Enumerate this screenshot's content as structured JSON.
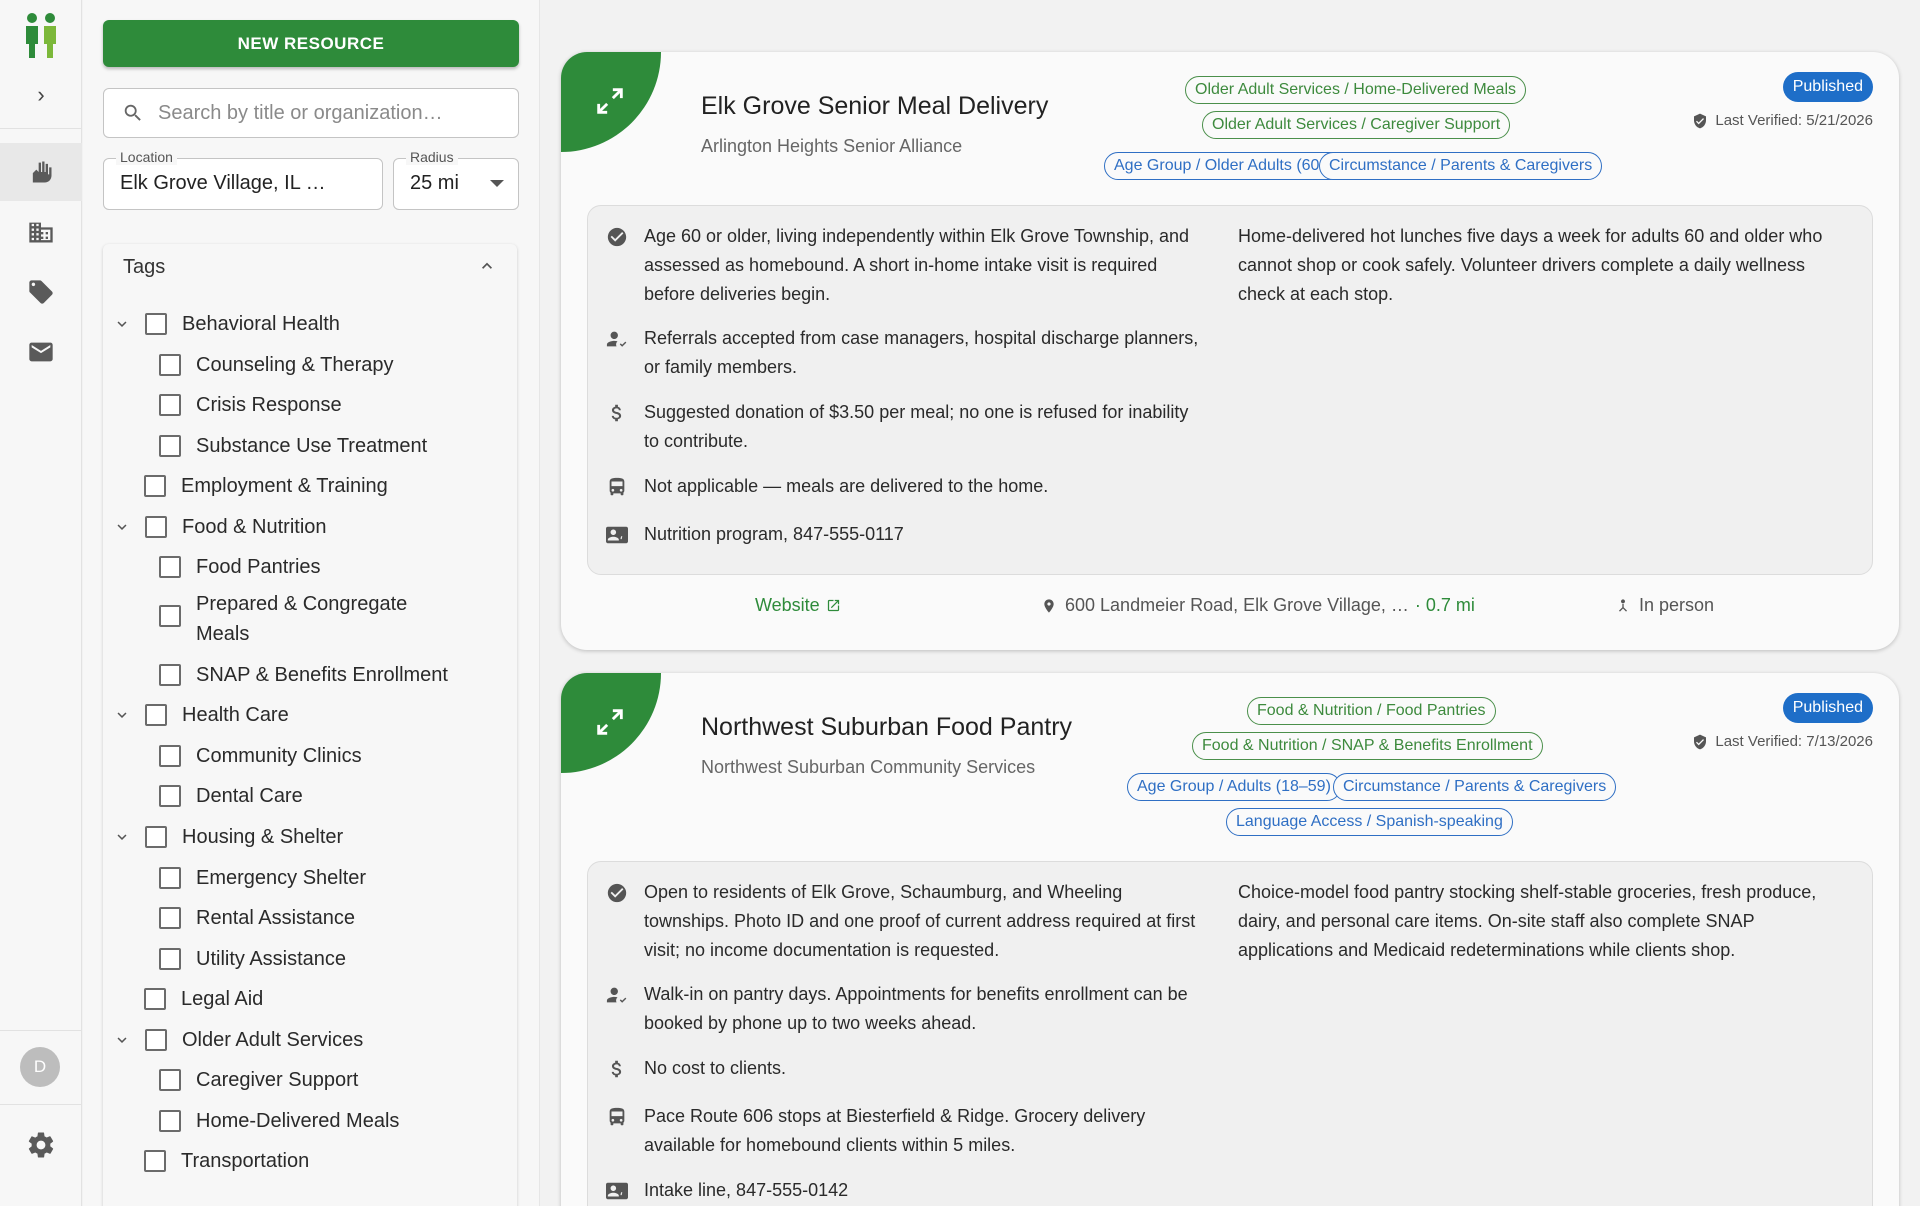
{
  "panel": {
    "new_resource_label": "NEW RESOURCE",
    "search_placeholder": "Search by title or organization…",
    "location_label": "Location",
    "location_value": "Elk Grove Village, IL …",
    "radius_label": "Radius",
    "radius_value": "25 mi",
    "tags_title": "Tags",
    "tags": [
      {
        "label": "Behavioral Health"
      },
      {
        "label": "Counseling & Therapy"
      },
      {
        "label": "Crisis Response"
      },
      {
        "label": "Substance Use Treatment"
      },
      {
        "label": "Employment & Training"
      },
      {
        "label": "Food & Nutrition"
      },
      {
        "label": "Food Pantries"
      },
      {
        "label": "Prepared & Congregate Meals"
      },
      {
        "label": "SNAP & Benefits Enrollment"
      },
      {
        "label": "Health Care"
      },
      {
        "label": "Community Clinics"
      },
      {
        "label": "Dental Care"
      },
      {
        "label": "Housing & Shelter"
      },
      {
        "label": "Emergency Shelter"
      },
      {
        "label": "Rental Assistance"
      },
      {
        "label": "Utility Assistance"
      },
      {
        "label": "Legal Aid"
      },
      {
        "label": "Older Adult Services"
      },
      {
        "label": "Caregiver Support"
      },
      {
        "label": "Home-Delivered Meals"
      },
      {
        "label": "Transportation"
      }
    ]
  },
  "rail": {
    "avatar_initial": "D"
  },
  "cards": [
    {
      "title": "Elk Grove Senior Meal Delivery",
      "organization": "Arlington Heights Senior Alliance",
      "status": "Published",
      "verified": "Last Verified: 5/21/2026",
      "tags": [
        "Older Adult Services / Home-Delivered Meals",
        "Older Adult Services / Caregiver Support",
        "Age Group / Older Adults (60+)",
        "Circumstance / Parents & Caregivers"
      ],
      "eligibility": "Age 60 or older, living independently within Elk Grove Township, and assessed as homebound. A short in-home intake visit is required before deliveries begin.",
      "referral": "Referrals accepted from case managers, hospital discharge planners, or family members.",
      "cost": "Suggested donation of $3.50 per meal; no one is refused for inability to contribute.",
      "transit": "Not applicable — meals are delivered to the home.",
      "contact": "Nutrition program, 847-555-0117",
      "description": "Home-delivered hot lunches five days a week for adults 60 and older who cannot shop or cook safely. Volunteer drivers complete a daily wellness check at each stop.",
      "website_label": "Website",
      "address": "600 Landmeier Road, Elk Grove Village, …",
      "distance": "· 0.7 mi",
      "mode": "In person"
    },
    {
      "title": "Northwest Suburban Food Pantry",
      "organization": "Northwest Suburban Community Services",
      "status": "Published",
      "verified": "Last Verified: 7/13/2026",
      "tags": [
        "Food & Nutrition / Food Pantries",
        "Food & Nutrition / SNAP & Benefits Enrollment",
        "Age Group / Adults (18–59)",
        "Circumstance / Parents & Caregivers",
        "Language Access / Spanish-speaking"
      ],
      "eligibility": "Open to residents of Elk Grove, Schaumburg, and Wheeling townships. Photo ID and one proof of current address required at first visit; no income documentation is requested.",
      "referral": "Walk-in on pantry days. Appointments for benefits enrollment can be booked by phone up to two weeks ahead.",
      "cost": "No cost to clients.",
      "transit": "Pace Route 606 stops at Biesterfield & Ridge. Grocery delivery available for homebound clients within 5 miles.",
      "contact": "Intake line, 847-555-0142",
      "description": "Choice-model food pantry stocking shelf-stable groceries, fresh produce, dairy, and personal care items. On-site staff also complete SNAP applications and Medicaid redeterminations while clients shop."
    }
  ],
  "colors": {
    "brand_green": "#2e8b3a",
    "published_blue": "#1e6ec8",
    "tag_blue": "#2f6fc4"
  }
}
